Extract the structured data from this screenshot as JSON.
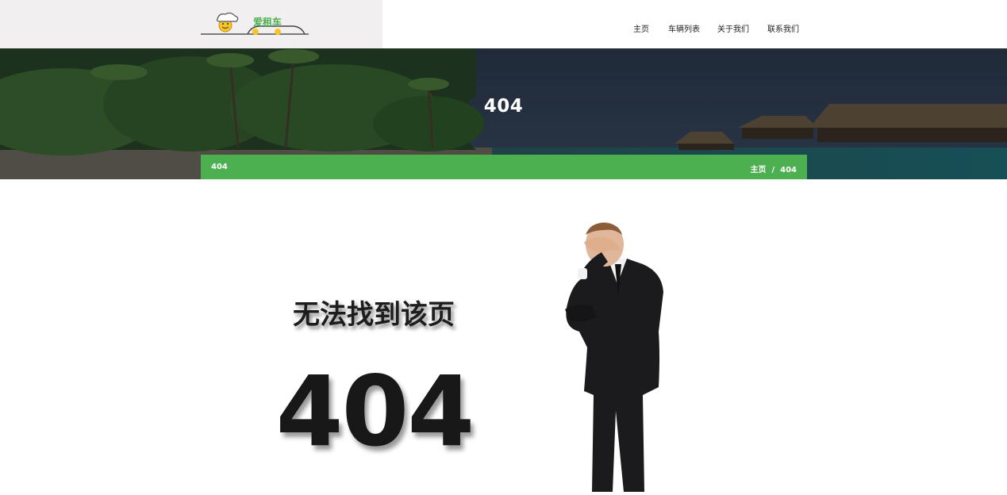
{
  "brand": {
    "logo_text": "爱租车"
  },
  "nav": {
    "items": [
      {
        "label": "主页"
      },
      {
        "label": "车辆列表"
      },
      {
        "label": "关于我们"
      },
      {
        "label": "联系我们"
      }
    ]
  },
  "hero": {
    "title": "404"
  },
  "breadcrumb": {
    "current": "404",
    "home": "主页",
    "separator": "/",
    "page": "404"
  },
  "error": {
    "message": "无法找到该页",
    "code": "404"
  },
  "colors": {
    "accent": "#4caf50",
    "header_left_bg": "#f1eff0",
    "text_dark": "#1d1d1d"
  }
}
